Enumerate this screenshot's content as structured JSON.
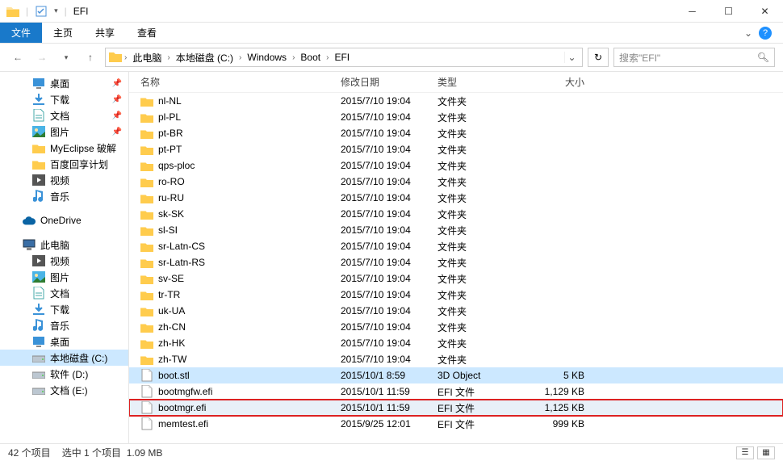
{
  "window": {
    "title": "EFI"
  },
  "ribbon": {
    "file": "文件",
    "home": "主页",
    "share": "共享",
    "view": "查看"
  },
  "nav": {
    "crumbs": [
      "此电脑",
      "本地磁盘 (C:)",
      "Windows",
      "Boot",
      "EFI"
    ],
    "search_placeholder": "搜索\"EFI\""
  },
  "sidebar": {
    "quick": [
      {
        "label": "桌面",
        "icon": "desktop",
        "pin": true
      },
      {
        "label": "下载",
        "icon": "download",
        "pin": true
      },
      {
        "label": "文档",
        "icon": "doc",
        "pin": true
      },
      {
        "label": "图片",
        "icon": "image",
        "pin": true
      },
      {
        "label": "MyEclipse 破解",
        "icon": "folder"
      },
      {
        "label": "百度回享计划",
        "icon": "folder"
      },
      {
        "label": "视频",
        "icon": "video"
      },
      {
        "label": "音乐",
        "icon": "music"
      }
    ],
    "onedrive": "OneDrive",
    "thispc": "此电脑",
    "thispc_items": [
      {
        "label": "视频",
        "icon": "video"
      },
      {
        "label": "图片",
        "icon": "image"
      },
      {
        "label": "文档",
        "icon": "doc"
      },
      {
        "label": "下载",
        "icon": "download"
      },
      {
        "label": "音乐",
        "icon": "music"
      },
      {
        "label": "桌面",
        "icon": "desktop"
      },
      {
        "label": "本地磁盘 (C:)",
        "icon": "drive",
        "sel": true
      },
      {
        "label": "软件 (D:)",
        "icon": "drive"
      },
      {
        "label": "文档 (E:)",
        "icon": "drive"
      }
    ]
  },
  "columns": {
    "name": "名称",
    "date": "修改日期",
    "type": "类型",
    "size": "大小"
  },
  "files": [
    {
      "name": "nl-NL",
      "date": "2015/7/10 19:04",
      "type": "文件夹",
      "size": "",
      "kind": "folder"
    },
    {
      "name": "pl-PL",
      "date": "2015/7/10 19:04",
      "type": "文件夹",
      "size": "",
      "kind": "folder"
    },
    {
      "name": "pt-BR",
      "date": "2015/7/10 19:04",
      "type": "文件夹",
      "size": "",
      "kind": "folder"
    },
    {
      "name": "pt-PT",
      "date": "2015/7/10 19:04",
      "type": "文件夹",
      "size": "",
      "kind": "folder"
    },
    {
      "name": "qps-ploc",
      "date": "2015/7/10 19:04",
      "type": "文件夹",
      "size": "",
      "kind": "folder"
    },
    {
      "name": "ro-RO",
      "date": "2015/7/10 19:04",
      "type": "文件夹",
      "size": "",
      "kind": "folder"
    },
    {
      "name": "ru-RU",
      "date": "2015/7/10 19:04",
      "type": "文件夹",
      "size": "",
      "kind": "folder"
    },
    {
      "name": "sk-SK",
      "date": "2015/7/10 19:04",
      "type": "文件夹",
      "size": "",
      "kind": "folder"
    },
    {
      "name": "sl-SI",
      "date": "2015/7/10 19:04",
      "type": "文件夹",
      "size": "",
      "kind": "folder"
    },
    {
      "name": "sr-Latn-CS",
      "date": "2015/7/10 19:04",
      "type": "文件夹",
      "size": "",
      "kind": "folder"
    },
    {
      "name": "sr-Latn-RS",
      "date": "2015/7/10 19:04",
      "type": "文件夹",
      "size": "",
      "kind": "folder"
    },
    {
      "name": "sv-SE",
      "date": "2015/7/10 19:04",
      "type": "文件夹",
      "size": "",
      "kind": "folder"
    },
    {
      "name": "tr-TR",
      "date": "2015/7/10 19:04",
      "type": "文件夹",
      "size": "",
      "kind": "folder"
    },
    {
      "name": "uk-UA",
      "date": "2015/7/10 19:04",
      "type": "文件夹",
      "size": "",
      "kind": "folder"
    },
    {
      "name": "zh-CN",
      "date": "2015/7/10 19:04",
      "type": "文件夹",
      "size": "",
      "kind": "folder"
    },
    {
      "name": "zh-HK",
      "date": "2015/7/10 19:04",
      "type": "文件夹",
      "size": "",
      "kind": "folder"
    },
    {
      "name": "zh-TW",
      "date": "2015/7/10 19:04",
      "type": "文件夹",
      "size": "",
      "kind": "folder"
    },
    {
      "name": "boot.stl",
      "date": "2015/10/1 8:59",
      "type": "3D Object",
      "size": "5 KB",
      "kind": "file",
      "sel": true
    },
    {
      "name": "bootmgfw.efi",
      "date": "2015/10/1 11:59",
      "type": "EFI 文件",
      "size": "1,129 KB",
      "kind": "file"
    },
    {
      "name": "bootmgr.efi",
      "date": "2015/10/1 11:59",
      "type": "EFI 文件",
      "size": "1,125 KB",
      "kind": "file",
      "hi": true
    },
    {
      "name": "memtest.efi",
      "date": "2015/9/25 12:01",
      "type": "EFI 文件",
      "size": "999 KB",
      "kind": "file"
    }
  ],
  "status": {
    "count": "42 个项目",
    "selection": "选中 1 个项目",
    "size": "1.09 MB"
  }
}
